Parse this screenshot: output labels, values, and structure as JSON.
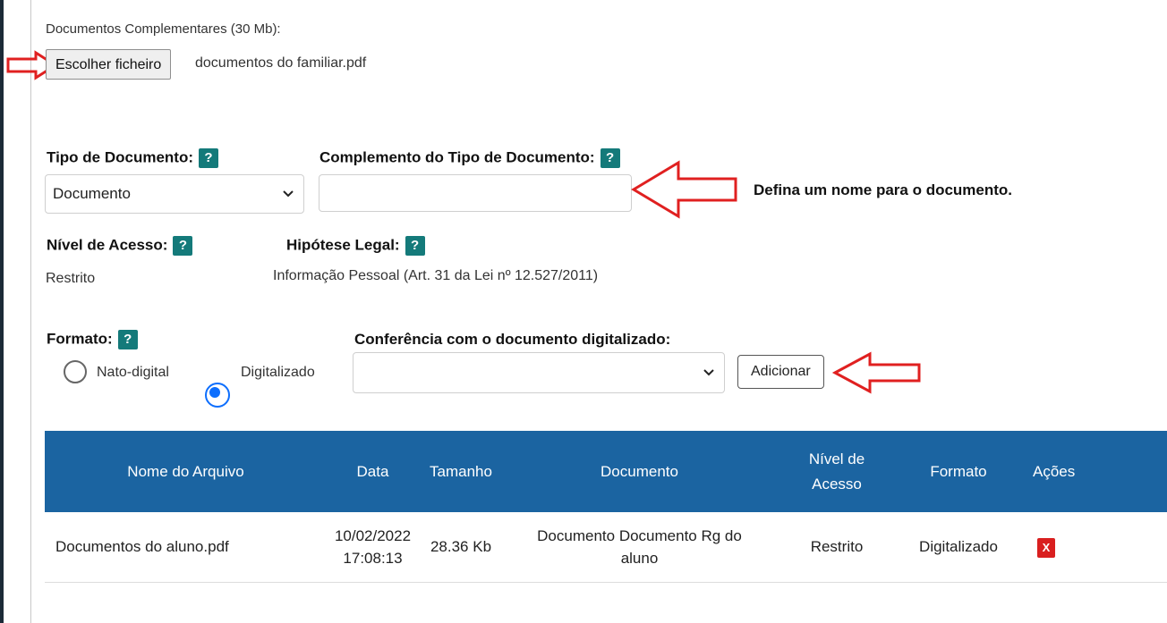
{
  "upload": {
    "label": "Documentos Complementares (30 Mb):",
    "choose_button": "Escolher ficheiro",
    "file_name": "documentos do familiar.pdf"
  },
  "form": {
    "tipo_label": "Tipo de Documento:",
    "tipo_value": "Documento",
    "complemento_label": "Complemento do Tipo de Documento:",
    "complemento_value": "",
    "annotation": "Defina um nome para o documento.",
    "nivel_label": "Nível de Acesso:",
    "nivel_value": "Restrito",
    "hipotese_label": "Hipótese Legal:",
    "hipotese_value": "Informação Pessoal (Art. 31 da Lei nº 12.527/2011)",
    "formato_label": "Formato:",
    "radio_nato": "Nato-digital",
    "radio_digitalizado": "Digitalizado",
    "conferencia_label": "Conferência com o documento digitalizado:",
    "conferencia_value": "",
    "add_button": "Adicionar",
    "help_glyph": "?"
  },
  "table": {
    "headers": {
      "nome": "Nome do Arquivo",
      "data": "Data",
      "tamanho": "Tamanho",
      "documento": "Documento",
      "nivel_line1": "Nível de",
      "nivel_line2": "Acesso",
      "formato": "Formato",
      "acoes": "Ações"
    },
    "rows": [
      {
        "nome": "Documentos do aluno.pdf",
        "data_line1": "10/02/2022",
        "data_line2": "17:08:13",
        "tamanho": "28.36 Kb",
        "documento_line1": "Documento Documento Rg do",
        "documento_line2": "aluno",
        "nivel": "Restrito",
        "formato": "Digitalizado",
        "acao": "X"
      }
    ]
  },
  "colors": {
    "table_header": "#1b64a1",
    "help_badge": "#147a7a",
    "annotation_arrow": "#e02020",
    "delete_button": "#d91f1f",
    "radio_selected": "#0d6efd"
  }
}
